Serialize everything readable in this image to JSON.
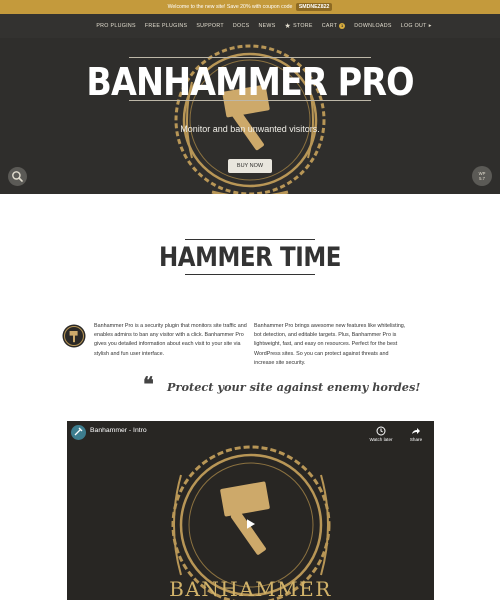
{
  "announcement": {
    "text": "Welcome to the new site! Save 20% with coupon code",
    "coupon": "SMDNEZ822"
  },
  "nav": {
    "items": [
      "PRO PLUGINS",
      "FREE PLUGINS",
      "SUPPORT",
      "DOCS",
      "NEWS",
      "STORE",
      "CART",
      "DOWNLOADS",
      "LOG OUT"
    ],
    "cart_count": "1",
    "store_icon": "star-icon",
    "logout_icon": "chevron-right-icon"
  },
  "hero": {
    "title": "BANHAMMER PRO",
    "subtitle": "Monitor and ban unwanted visitors.",
    "button": "BUY NOW",
    "wp_badge_line1": "WP",
    "wp_badge_line2": "5.7",
    "search_icon": "search-icon"
  },
  "about": {
    "heading": "HAMMER TIME",
    "col1": "Banhammer Pro is a security plugin that monitors site traffic and enables admins to ban any visitor with a click. Banhammer Pro gives you detailed information about each visit to your site via stylish and fun user interface.",
    "col2": "Banhammer Pro brings awesome new features like whitelisting, bot detection, and editable targets. Plus, Banhammer Pro is lightweight, fast, and easy on resources. Perfect for the best WordPress sites. So you can protect against threats and increase site security."
  },
  "quote": {
    "mark": "❝",
    "text": "Protect your site against enemy hordes!"
  },
  "video": {
    "title": "Banhammer - Intro",
    "watch_later": "Watch later",
    "share": "Share",
    "wordmark": "BANHAMMER"
  },
  "colors": {
    "gold": "#c49a3c",
    "nav_bg": "#333230",
    "hero_bg": "#2f2e2c",
    "emblem": "#b89656",
    "hammer": "#cda96a"
  }
}
